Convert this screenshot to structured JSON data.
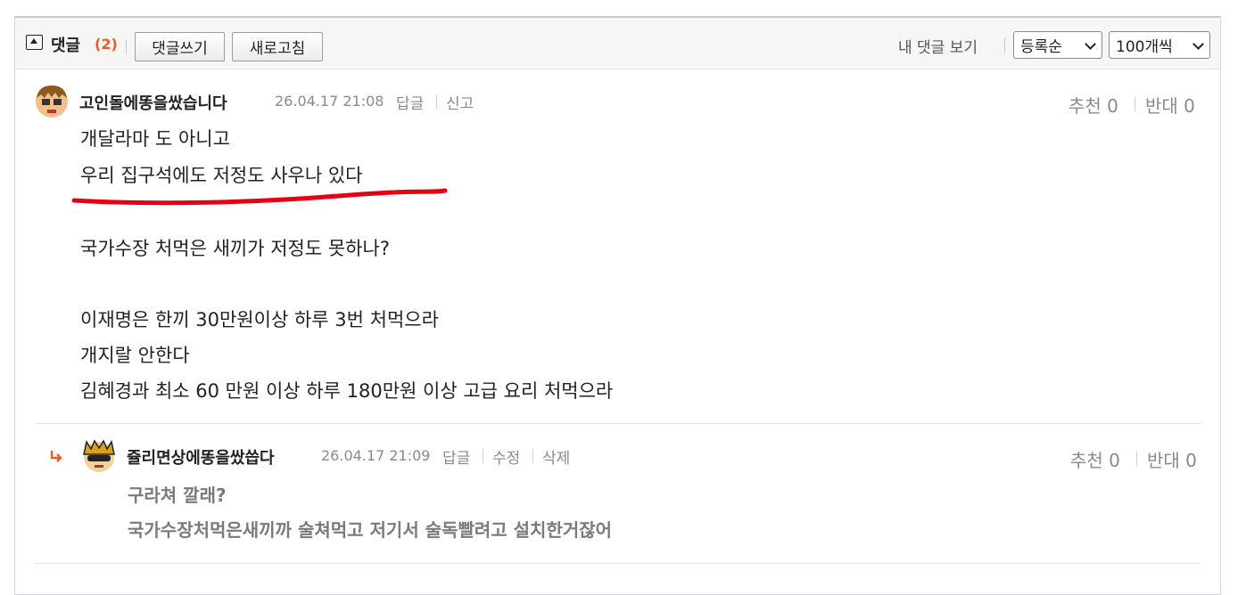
{
  "header": {
    "title": "댓글",
    "count": "(2)",
    "write_label": "댓글쓰기",
    "refresh_label": "새로고침",
    "my_comments_label": "내 댓글 보기",
    "sort_value": "등록순",
    "per_page_value": "100개씩"
  },
  "comments": [
    {
      "author": "고인돌에똥을쌌습니다",
      "date": "26.04.17 21:08",
      "actions": [
        "답글",
        "신고"
      ],
      "recommend_label": "추천",
      "recommend_count": "0",
      "oppose_label": "반대",
      "oppose_count": "0",
      "lines": [
        "개달라마 도 아니고",
        "우리 집구석에도 저정도 사우나 있다",
        "",
        "국가수장 처먹은 새끼가 저정도 못하나?",
        "",
        "이재명은 한끼 30만원이상 하루 3번 처먹으라",
        "개지랄 안한다",
        "김혜경과 최소 60 만원 이상 하루 180만원 이상 고급 요리 처먹으라"
      ]
    },
    {
      "author": "쥴리면상에똥을쌌씁다",
      "date": "26.04.17 21:09",
      "actions": [
        "답글",
        "수정",
        "삭제"
      ],
      "recommend_label": "추천",
      "recommend_count": "0",
      "oppose_label": "반대",
      "oppose_count": "0",
      "lines": [
        "구라쳐 깔래?",
        "국가수장처먹은새끼까 술쳐먹고 저기서 술독빨려고 설치한거잖어"
      ]
    }
  ],
  "colors": {
    "accent_count": "#f05a22",
    "reply_arrow": "#f05a22",
    "annotation_underline": "#e60012"
  },
  "icons": [
    "collapse-toggle-icon",
    "chevron-down-icon",
    "reply-arrow-icon",
    "avatar-icon"
  ]
}
